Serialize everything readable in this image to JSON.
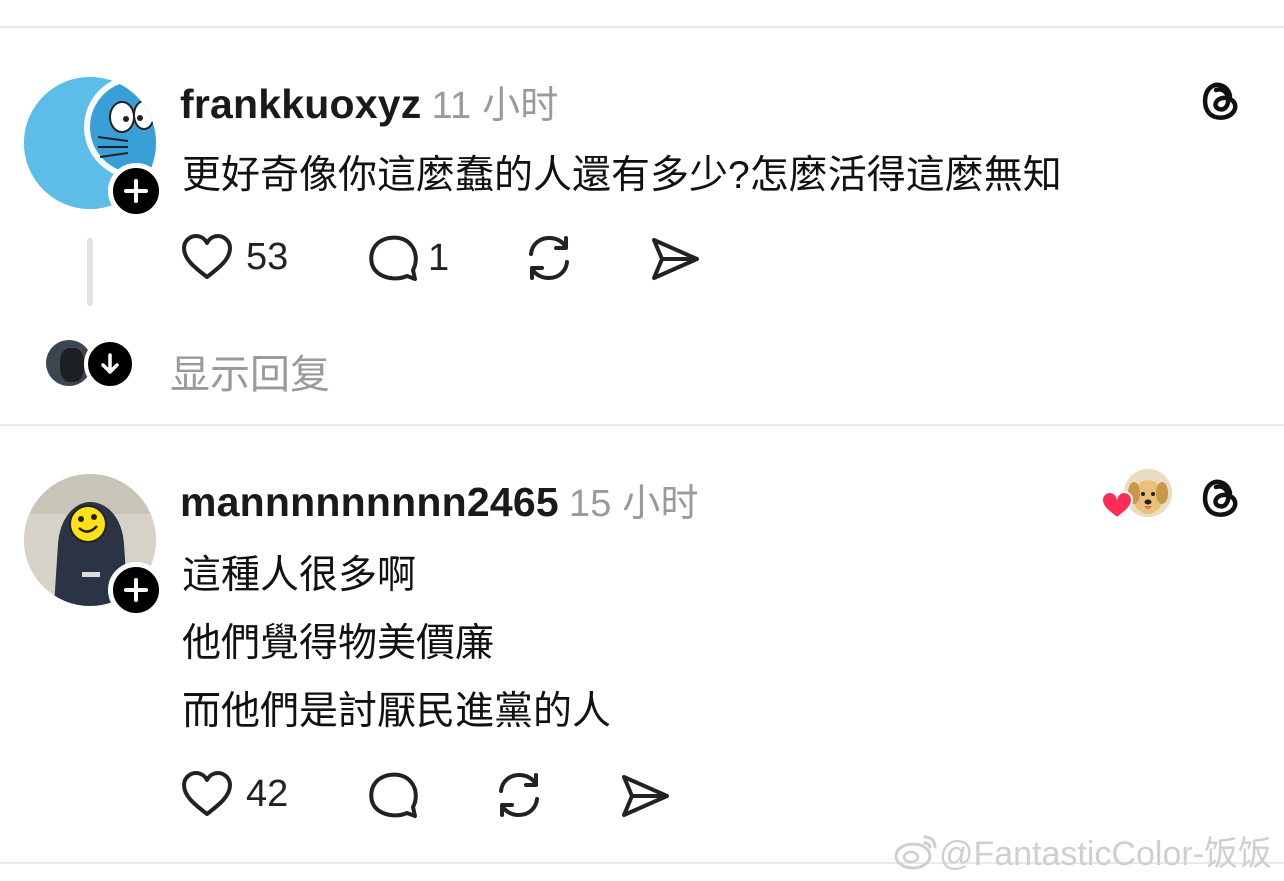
{
  "post1": {
    "username": "frankkuoxyz",
    "time": "11 小时",
    "text": "更好奇像你這麼蠢的人還有多少?怎麼活得這麼無知",
    "likes": "53",
    "replies": "1",
    "show_replies": "显示回复"
  },
  "post2": {
    "username": "mannnnnnnnn2465",
    "time": "15 小时",
    "lines": [
      "這種人很多啊",
      "他們覺得物美價廉",
      "而他們是討厭民進黨的人"
    ],
    "likes": "42"
  },
  "watermark": "@FantasticColor-饭饭",
  "icons": {
    "like": "heart-icon",
    "comment": "comment-bubble-icon",
    "repost": "repost-icon",
    "share": "send-icon",
    "threads": "threads-logo-icon",
    "add": "plus-icon",
    "expand": "arrow-down-icon"
  },
  "colors": {
    "accent_heart": "#ff2d55",
    "avatar_blue": "#5bbde8",
    "muted_text": "#9a9a9a"
  }
}
